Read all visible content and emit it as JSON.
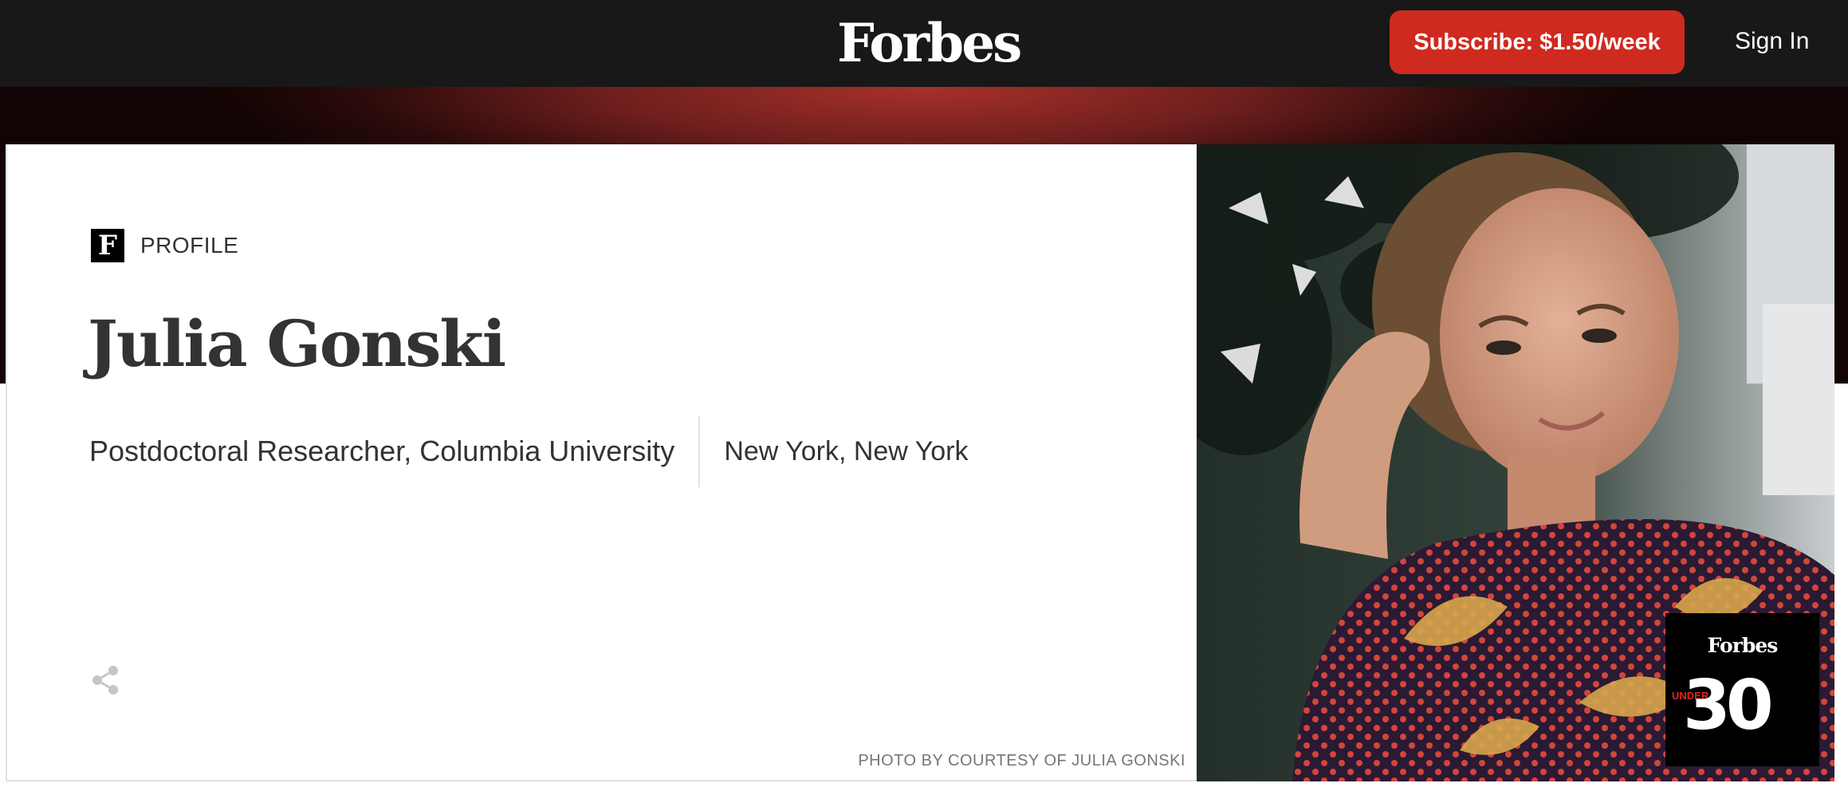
{
  "header": {
    "brand": "Forbes",
    "subscribe_label": "Subscribe: $1.50/week",
    "signin_label": "Sign In"
  },
  "profile": {
    "section_label": "PROFILE",
    "logo_letter": "F",
    "name": "Julia Gonski",
    "title": "Postdoctoral Researcher, Columbia University",
    "location": "New York, New York",
    "share_icon": "share-icon",
    "photo_credit": "PHOTO BY COURTESY OF JULIA GONSKI"
  },
  "badge": {
    "brand": "Forbes",
    "under": "UNDER",
    "number": "30"
  },
  "colors": {
    "topbar": "#181818",
    "subscribe": "#cf2a1f",
    "accent_red": "#a8302a",
    "text": "#333333"
  }
}
